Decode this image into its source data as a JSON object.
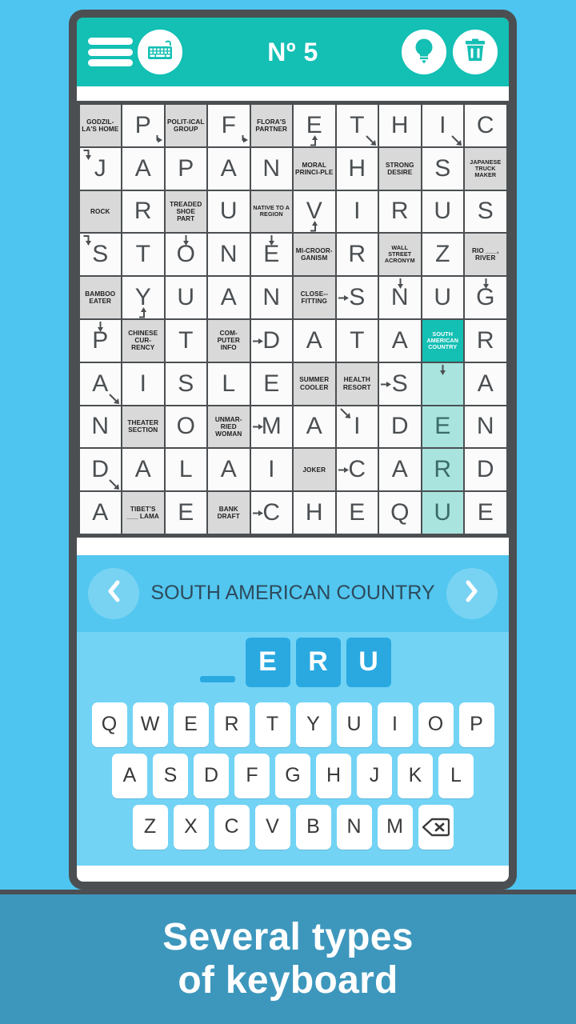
{
  "background_color": "#4ec5f1",
  "appbar": {
    "title": "Nº 5",
    "menu_icon": "hamburger-icon",
    "keyboard_icon": "keyboard-icon",
    "hint_icon": "lightbulb-icon",
    "delete_icon": "trash-icon",
    "background_color": "#14bfb4"
  },
  "grid": {
    "rows": 10,
    "cols": 10,
    "clue_cell_color": "#d9d9d9",
    "active_clue_color": "#14bfb4",
    "highlight_color": "#a9e4df",
    "cells": [
      [
        {
          "t": "clue",
          "text": "GODZIL-LA'S HOME"
        },
        {
          "t": "letter",
          "text": "P",
          "arrow": "down-right-br"
        },
        {
          "t": "clue",
          "text": "POLIT-ICAL GROUP"
        },
        {
          "t": "letter",
          "text": "F",
          "arrow": "down-right-br"
        },
        {
          "t": "clue",
          "text": "FLORA'S PARTNER"
        },
        {
          "t": "letter",
          "text": "E",
          "arrow": "right-up-bl"
        },
        {
          "t": "letter",
          "text": "T",
          "arrow": "diag-br"
        },
        {
          "t": "letter",
          "text": "H"
        },
        {
          "t": "letter",
          "text": "I",
          "arrow": "diag-br"
        },
        {
          "t": "letter",
          "text": "C"
        }
      ],
      [
        {
          "t": "letter",
          "text": "J",
          "arrow": "right-down-tl"
        },
        {
          "t": "letter",
          "text": "A"
        },
        {
          "t": "letter",
          "text": "P"
        },
        {
          "t": "letter",
          "text": "A"
        },
        {
          "t": "letter",
          "text": "N"
        },
        {
          "t": "clue",
          "text": "MORAL PRINCI-PLE"
        },
        {
          "t": "letter",
          "text": "H"
        },
        {
          "t": "clue",
          "text": "STRONG DESIRE"
        },
        {
          "t": "letter",
          "text": "S"
        },
        {
          "t": "clue",
          "small": true,
          "text": "JAPANESE TRUCK MAKER"
        }
      ],
      [
        {
          "t": "clue",
          "text": "ROCK"
        },
        {
          "t": "letter",
          "text": "R"
        },
        {
          "t": "clue",
          "text": "TREADED SHOE PART"
        },
        {
          "t": "letter",
          "text": "U"
        },
        {
          "t": "clue",
          "small": true,
          "text": "NATIVE TO A REGION"
        },
        {
          "t": "letter",
          "text": "V",
          "arrow": "right-up-bl"
        },
        {
          "t": "letter",
          "text": "I"
        },
        {
          "t": "letter",
          "text": "R"
        },
        {
          "t": "letter",
          "text": "U"
        },
        {
          "t": "letter",
          "text": "S"
        }
      ],
      [
        {
          "t": "letter",
          "text": "S",
          "arrow": "right-down-tl"
        },
        {
          "t": "letter",
          "text": "T"
        },
        {
          "t": "letter",
          "text": "O",
          "arrow": "down-tc"
        },
        {
          "t": "letter",
          "text": "N"
        },
        {
          "t": "letter",
          "text": "E",
          "arrow": "down-tc"
        },
        {
          "t": "clue",
          "text": "MI-CROOR-GANISM"
        },
        {
          "t": "letter",
          "text": "R"
        },
        {
          "t": "clue",
          "small": true,
          "text": "WALL STREET ACRONYM"
        },
        {
          "t": "letter",
          "text": "Z"
        },
        {
          "t": "clue",
          "text": "RIO ___, RIVER"
        }
      ],
      [
        {
          "t": "clue",
          "text": "BAMBOO EATER"
        },
        {
          "t": "letter",
          "text": "Y",
          "arrow": "up-right-bl"
        },
        {
          "t": "letter",
          "text": "U"
        },
        {
          "t": "letter",
          "text": "A"
        },
        {
          "t": "letter",
          "text": "N"
        },
        {
          "t": "clue",
          "text": "CLOSE--FITTING"
        },
        {
          "t": "letter",
          "text": "S",
          "arrow": "right-lft"
        },
        {
          "t": "letter",
          "text": "N",
          "arrow": "down-tc"
        },
        {
          "t": "letter",
          "text": "U"
        },
        {
          "t": "letter",
          "text": "G",
          "arrow": "down-tc"
        }
      ],
      [
        {
          "t": "letter",
          "text": "P",
          "arrow": "down-tc"
        },
        {
          "t": "clue",
          "text": "CHINESE CUR-RENCY"
        },
        {
          "t": "letter",
          "text": "T"
        },
        {
          "t": "clue",
          "text": "COM-PUTER INFO"
        },
        {
          "t": "letter",
          "text": "D",
          "arrow": "right-lft"
        },
        {
          "t": "letter",
          "text": "A"
        },
        {
          "t": "letter",
          "text": "T"
        },
        {
          "t": "letter",
          "text": "A"
        },
        {
          "t": "clue",
          "active": true,
          "small": true,
          "text": "SOUTH AMERICAN COUNTRY"
        },
        {
          "t": "letter",
          "text": "R"
        }
      ],
      [
        {
          "t": "letter",
          "text": "A",
          "arrow": "diag-br"
        },
        {
          "t": "letter",
          "text": "I"
        },
        {
          "t": "letter",
          "text": "S"
        },
        {
          "t": "letter",
          "text": "L"
        },
        {
          "t": "letter",
          "text": "E"
        },
        {
          "t": "clue",
          "text": "SUMMER COOLER"
        },
        {
          "t": "clue",
          "text": "HEALTH RESORT"
        },
        {
          "t": "letter",
          "text": "S",
          "arrow": "right-lft"
        },
        {
          "t": "letter",
          "text": "",
          "hl": true,
          "arrow": "down-tc"
        },
        {
          "t": "letter",
          "text": "A"
        }
      ],
      [
        {
          "t": "letter",
          "text": "N"
        },
        {
          "t": "clue",
          "text": "THEATER SECTION"
        },
        {
          "t": "letter",
          "text": "O"
        },
        {
          "t": "clue",
          "text": "UNMAR-RIED WOMAN"
        },
        {
          "t": "letter",
          "text": "M",
          "arrow": "right-lft"
        },
        {
          "t": "letter",
          "text": "A"
        },
        {
          "t": "letter",
          "text": "I",
          "arrow": "diag-tl"
        },
        {
          "t": "letter",
          "text": "D"
        },
        {
          "t": "letter",
          "text": "E",
          "hl": true
        },
        {
          "t": "letter",
          "text": "N"
        }
      ],
      [
        {
          "t": "letter",
          "text": "D",
          "arrow": "diag-br"
        },
        {
          "t": "letter",
          "text": "A"
        },
        {
          "t": "letter",
          "text": "L"
        },
        {
          "t": "letter",
          "text": "A"
        },
        {
          "t": "letter",
          "text": "I"
        },
        {
          "t": "clue",
          "text": "JOKER"
        },
        {
          "t": "letter",
          "text": "C",
          "arrow": "right-lft"
        },
        {
          "t": "letter",
          "text": "A"
        },
        {
          "t": "letter",
          "text": "R",
          "hl": true
        },
        {
          "t": "letter",
          "text": "D"
        }
      ],
      [
        {
          "t": "letter",
          "text": "A"
        },
        {
          "t": "clue",
          "text": "TIBET'S ___ LAMA"
        },
        {
          "t": "letter",
          "text": "E"
        },
        {
          "t": "clue",
          "text": "BANK DRAFT"
        },
        {
          "t": "letter",
          "text": "C",
          "arrow": "right-lft"
        },
        {
          "t": "letter",
          "text": "H"
        },
        {
          "t": "letter",
          "text": "E"
        },
        {
          "t": "letter",
          "text": "Q"
        },
        {
          "t": "letter",
          "text": "U",
          "hl": true
        },
        {
          "t": "letter",
          "text": "E"
        }
      ]
    ]
  },
  "clue_nav": {
    "prev_icon": "chevron-left-icon",
    "next_icon": "chevron-right-icon",
    "clue_text": "SOUTH AMERICAN COUNTRY",
    "background_color": "#53c7f0"
  },
  "answer": {
    "tiles": [
      "",
      "E",
      "R",
      "U"
    ],
    "tile_color": "#2aa9e0"
  },
  "keyboard": {
    "background_color": "#72d3f5",
    "rows": [
      [
        "Q",
        "W",
        "E",
        "R",
        "T",
        "Y",
        "U",
        "I",
        "O",
        "P"
      ],
      [
        "A",
        "S",
        "D",
        "F",
        "G",
        "H",
        "J",
        "K",
        "L"
      ],
      [
        "Z",
        "X",
        "C",
        "V",
        "B",
        "N",
        "M"
      ]
    ],
    "backspace_icon": "backspace-icon"
  },
  "caption": {
    "line1": "Several types",
    "line2": "of keyboard",
    "background_color": "#3d97bd"
  }
}
